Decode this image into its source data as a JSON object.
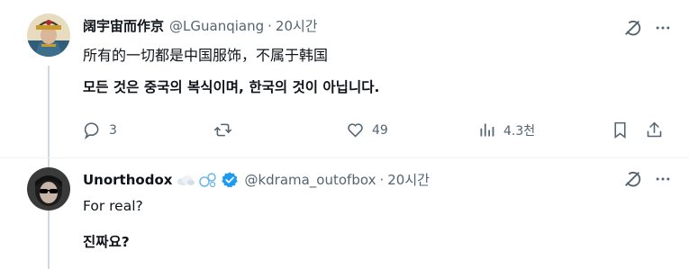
{
  "post": {
    "author_name": "阔宇宙而作京",
    "handle": "@LGuanqiang",
    "separator": "·",
    "time": "20시간",
    "text_zh": "所有的一切都是中国服饰，不属于韩国",
    "text_ko": "모든 것은 중국의 복식이며, 한국의 것이 아닙니다.",
    "stats": {
      "replies": "3",
      "likes": "49",
      "views": "4.3천"
    }
  },
  "reply": {
    "author_name": "Unorthodox",
    "handle": "@kdrama_outofbox",
    "separator": "·",
    "time": "20시간",
    "text_en": "For real?",
    "text_ko": "진짜요?"
  },
  "colors": {
    "text": "#0f1419",
    "secondary": "#536471",
    "verified": "#1d9bf0",
    "thread_line": "#cfd9de"
  }
}
